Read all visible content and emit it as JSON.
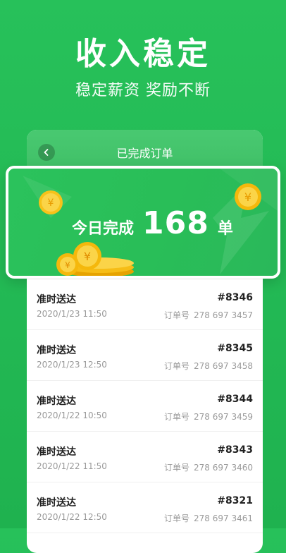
{
  "hero": {
    "title": "收入稳定",
    "subtitle": "稳定薪资 奖励不断"
  },
  "panel": {
    "title": "已完成订单",
    "back_icon": "chevron-left-icon"
  },
  "stat": {
    "prefix": "今日完成",
    "count": "168",
    "unit": "单"
  },
  "orders": [
    {
      "status": "准时送达",
      "id": "#8346",
      "date": "2020/1/23  11:50",
      "no_label": "订单号",
      "no": "278 697 3457"
    },
    {
      "status": "准时送达",
      "id": "#8345",
      "date": "2020/1/23 12:50",
      "no_label": "订单号",
      "no": "278 697 3458"
    },
    {
      "status": "准时送达",
      "id": "#8344",
      "date": "2020/1/22 10:50",
      "no_label": "订单号",
      "no": "278 697 3459"
    },
    {
      "status": "准时送达",
      "id": "#8343",
      "date": "2020/1/22 11:50",
      "no_label": "订单号",
      "no": "278 697 3460"
    },
    {
      "status": "准时送达",
      "id": "#8321",
      "date": "2020/1/22 12:50",
      "no_label": "订单号",
      "no": "278 697 3461"
    }
  ],
  "colors": {
    "brand_green": "#27c15a",
    "coin_gold": "#f5b80c"
  }
}
